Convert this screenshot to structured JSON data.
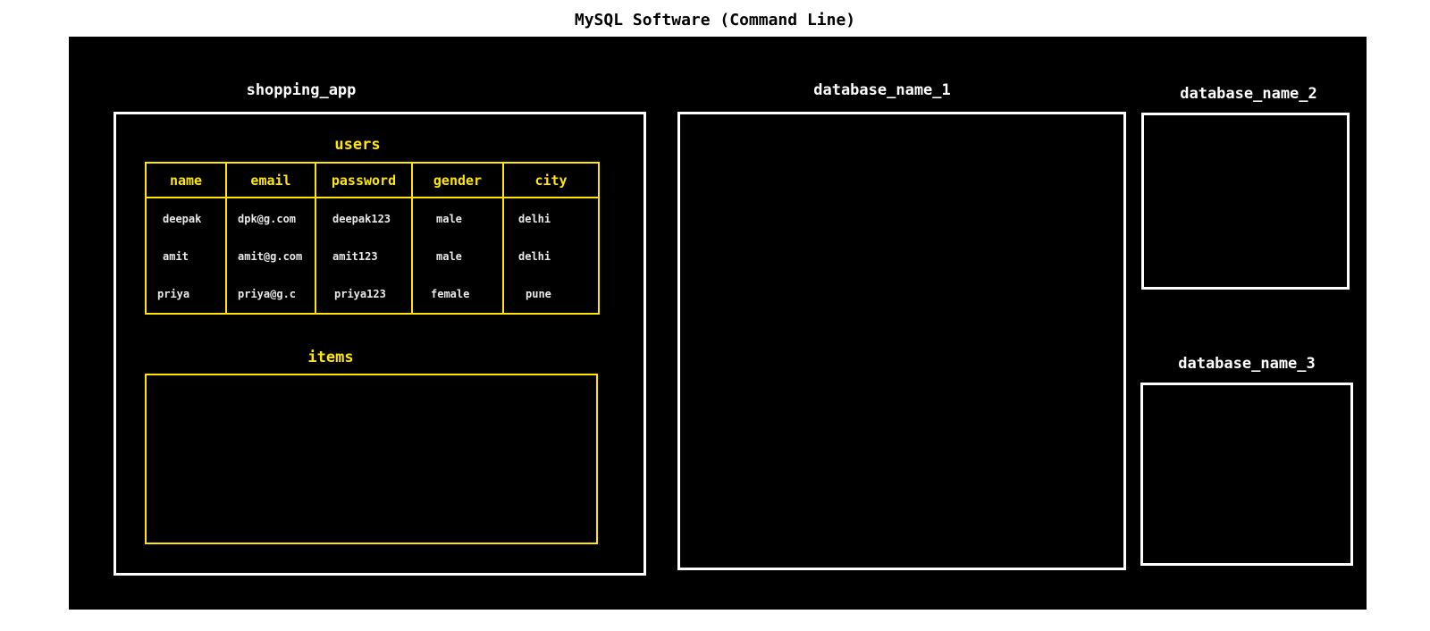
{
  "title": "MySQL Software (Command Line)",
  "colors": {
    "background": "#000000",
    "database_border": "#ffffff",
    "table_accent": "#ffe600",
    "cell_text": "#e8e8e8"
  },
  "databases": [
    {
      "name": "shopping_app",
      "tables": [
        {
          "name": "users",
          "columns": [
            "name",
            "email",
            "password",
            "gender",
            "city"
          ],
          "rows": [
            [
              "deepak",
              "dpk@g.com",
              "deepak123",
              "male",
              "delhi"
            ],
            [
              "amit",
              "amit@g.com",
              "amit123",
              "male",
              "delhi"
            ],
            [
              "priya",
              "priya@g.c",
              "priya123",
              "female",
              "pune"
            ]
          ]
        },
        {
          "name": "items",
          "columns": [],
          "rows": []
        }
      ]
    },
    {
      "name": "database_name_1"
    },
    {
      "name": "database_name_2"
    },
    {
      "name": "database_name_3"
    }
  ]
}
